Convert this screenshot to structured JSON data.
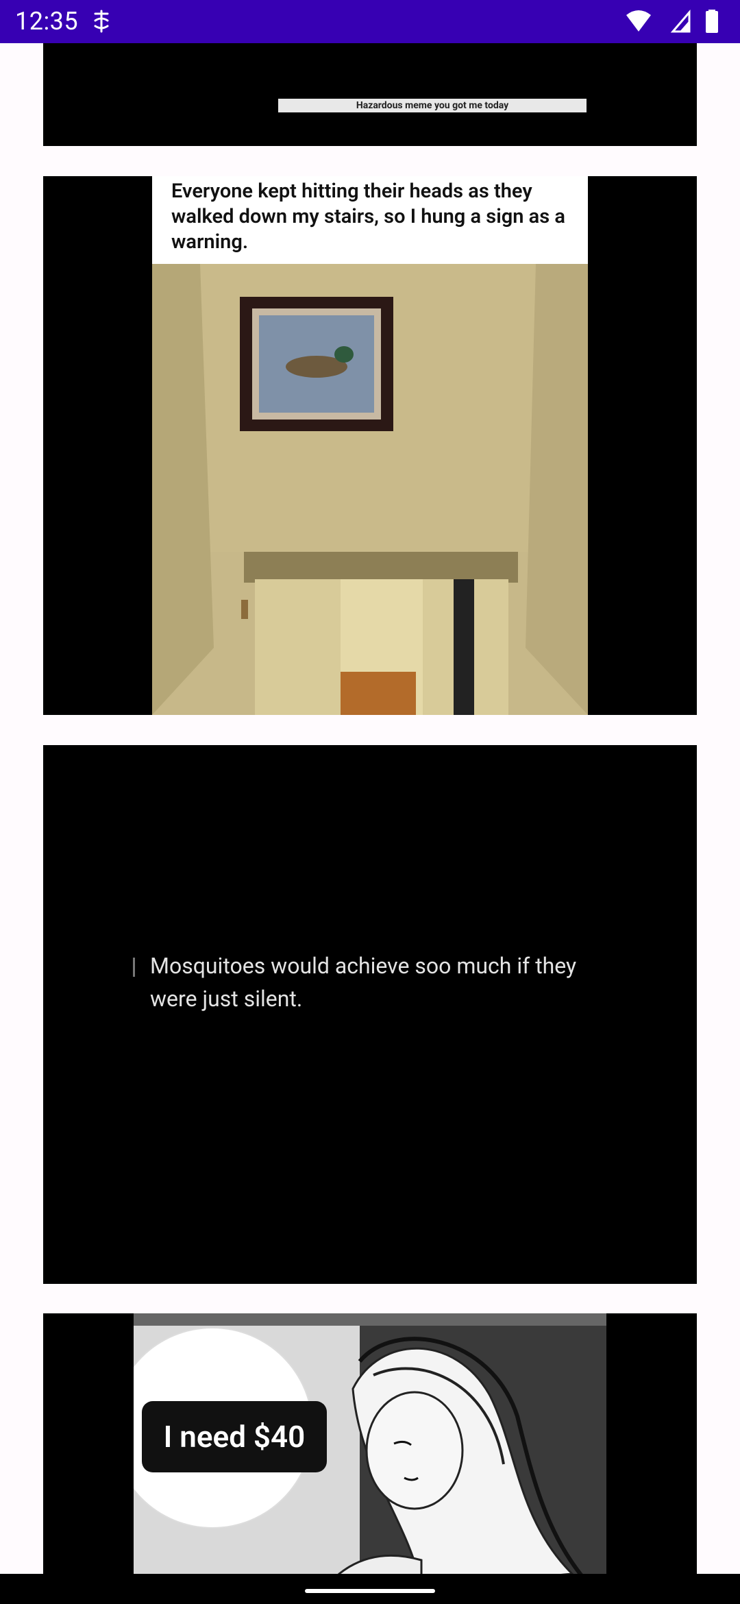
{
  "status_bar": {
    "time": "12:35",
    "icons": [
      "dnd-icon",
      "wifi-icon",
      "signal-icon",
      "battery-icon"
    ],
    "background": "#3700b3"
  },
  "feed": {
    "posts": [
      {
        "caption_strip": "Hazardous meme you got me today"
      },
      {
        "caption": "Everyone kept hitting their heads as they walked down my stairs, so I hung a sign as a warning."
      },
      {
        "quote": "Mosquitoes would achieve soo much if they were just silent."
      },
      {
        "speech": "I need $40"
      }
    ]
  }
}
